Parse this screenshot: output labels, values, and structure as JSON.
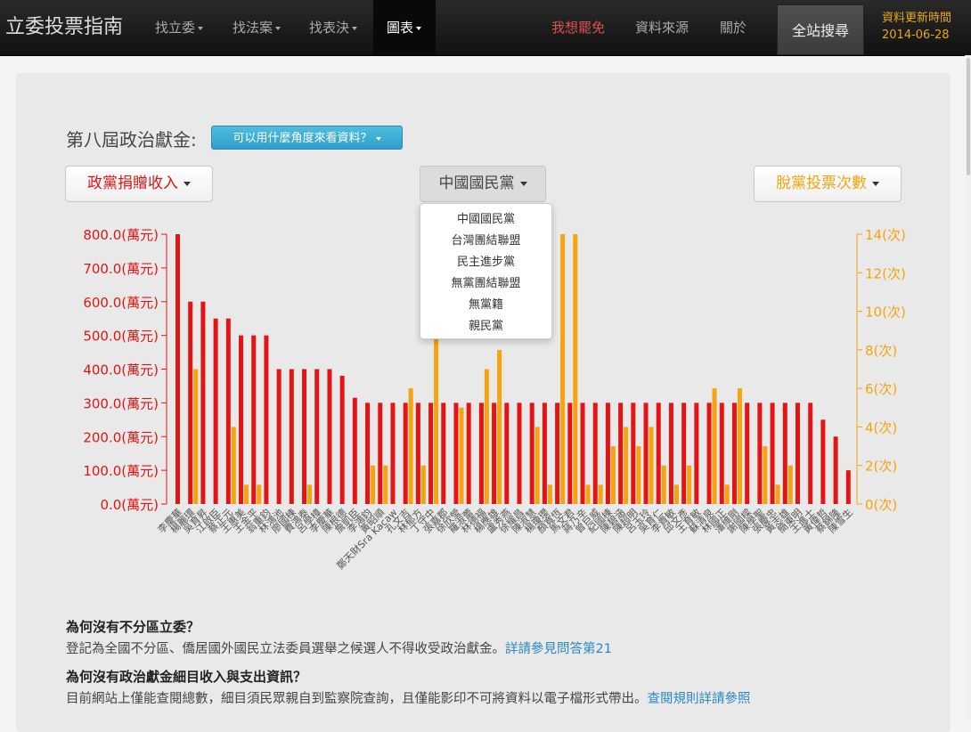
{
  "navbar": {
    "brand": "立委投票指南",
    "items": [
      "找立委",
      "找法案",
      "找表決",
      "圖表"
    ],
    "recall": "我想罷免",
    "sources": "資料來源",
    "about": "關於",
    "search": "全站搜尋",
    "update_label": "資料更新時間",
    "update_date": "2014-06-28"
  },
  "section": {
    "title": "第八屆政治獻金:",
    "info_button": "可以用什麼角度來看資料？"
  },
  "dropdowns": {
    "left": "政黨捐贈收入",
    "middle": "中國國民黨",
    "right": "脫黨投票次數",
    "menu_items": [
      "中國國民黨",
      "台灣團結聯盟",
      "民主進步黨",
      "無黨團結聯盟",
      "無黨籍",
      "親民黨"
    ]
  },
  "colors": {
    "left_series": "#e41414",
    "right_series": "#f5a30f"
  },
  "chart_data": {
    "type": "bar",
    "left_axis": {
      "ticks": [
        "800.0(萬元)",
        "700.0(萬元)",
        "600.0(萬元)",
        "500.0(萬元)",
        "400.0(萬元)",
        "300.0(萬元)",
        "200.0(萬元)",
        "100.0(萬元)",
        "0.0(萬元)"
      ],
      "ylim": [
        0,
        800
      ]
    },
    "right_axis": {
      "ticks": [
        "14(次)",
        "12(次)",
        "10(次)",
        "8(次)",
        "6(次)",
        "4(次)",
        "2(次)",
        "0(次)"
      ],
      "ylim": [
        0,
        14
      ]
    },
    "categories": [
      "李慶華",
      "楊麗環",
      "吳育昇",
      "江啟臣",
      "蔡正元",
      "王惠美",
      "王金平",
      "翁重鈞",
      "林鴻池",
      "廖國棟",
      "費鴻泰",
      "呂學樟",
      "李慶華",
      "陳根德",
      "詹凱臣",
      "李鴻鈞",
      "黃昭順",
      "鄭天財Sra Kacaw",
      "孔文吉",
      "林郁方",
      "丁守中",
      "張嘉郡",
      "徐欣瑩",
      "羅淑蕾",
      "林德福",
      "楊應雄",
      "盧秀燕",
      "徐耀昌",
      "陳淑慧",
      "楊瓊瓔",
      "顏寬恆",
      "馬文君",
      "蔣乃辛",
      "曾巨威",
      "紀國棟",
      "陳碧涵",
      "陳超明",
      "呂玉玲",
      "吳育仁",
      "李貴敏",
      "邱文彥",
      "王育敏",
      "蘇清泉",
      "林國正",
      "潘維剛",
      "謝國樑",
      "陳學聖",
      "張慶忠",
      "黃志雄",
      "簡東明",
      "王進士",
      "黃偉哲",
      "蔡錦隆",
      "陳雪生"
    ],
    "series": [
      {
        "name": "政黨捐贈收入",
        "axis": "left",
        "values": [
          800,
          600,
          600,
          550,
          550,
          500,
          500,
          500,
          400,
          400,
          400,
          400,
          400,
          380,
          315,
          300,
          300,
          300,
          300,
          300,
          300,
          300,
          300,
          300,
          300,
          300,
          300,
          300,
          300,
          300,
          300,
          300,
          300,
          300,
          300,
          300,
          300,
          300,
          300,
          300,
          300,
          300,
          300,
          300,
          300,
          300,
          300,
          300,
          300,
          300,
          300,
          250,
          200,
          100
        ]
      },
      {
        "name": "脫黨投票次數",
        "axis": "right",
        "values": [
          0,
          7,
          0,
          0,
          4,
          1,
          1,
          0,
          0,
          0,
          1,
          0,
          0,
          0,
          0,
          2,
          2,
          0,
          6,
          2,
          9,
          0,
          5,
          0,
          7,
          8,
          0,
          0,
          4,
          1,
          14,
          14,
          1,
          1,
          3,
          4,
          3,
          4,
          2,
          1,
          2,
          0,
          6,
          1,
          6,
          0,
          3,
          1,
          2,
          0,
          0,
          0,
          0,
          0
        ]
      }
    ]
  },
  "faq": [
    {
      "q": "為何沒有不分區立委？",
      "a": "登記為全國不分區、僑居國外國民立法委員選舉之候選人不得收受政治獻金。",
      "link": "詳請參見問答第21"
    },
    {
      "q": "為何沒有政治獻金細目收入與支出資訊？",
      "a": "目前網站上僅能查閱總數，細目須民眾親自到監察院查詢，且僅能影印不可將資料以電子檔形式帶出。",
      "link": "查閱規則詳請參照"
    }
  ]
}
